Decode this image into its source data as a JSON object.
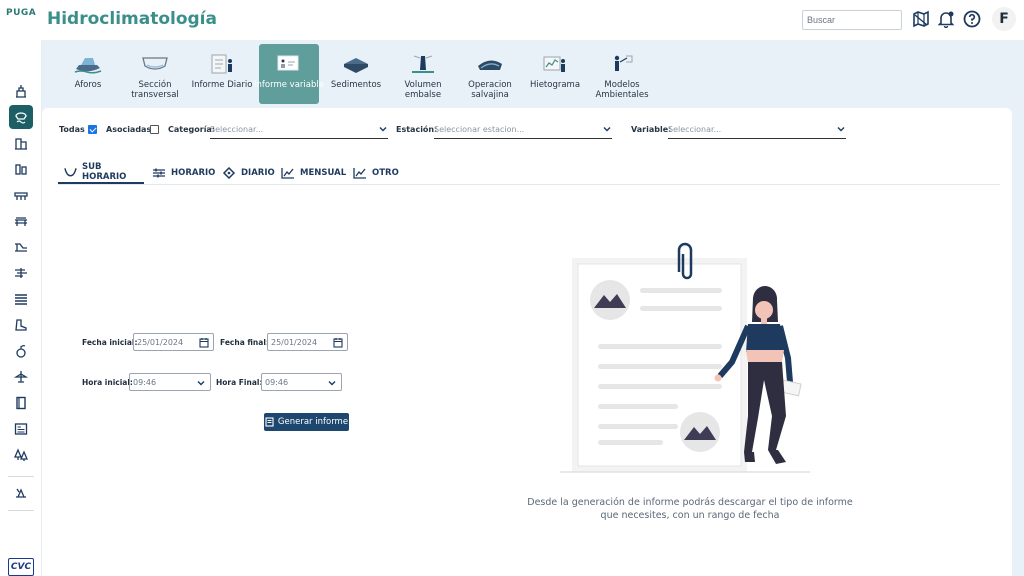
{
  "app": {
    "logo": "PUGA",
    "title": "Hidroclimatología"
  },
  "header": {
    "search_placeholder": "Buscar",
    "avatar_initial": "F"
  },
  "sidebar": {
    "footer_logo": "CVC"
  },
  "modules": [
    {
      "label": "Aforos",
      "active": false
    },
    {
      "label": "Sección transversal",
      "active": false
    },
    {
      "label": "Informe Diario",
      "active": false
    },
    {
      "label": "Informe variable",
      "active": true
    },
    {
      "label": "Sedimentos",
      "active": false
    },
    {
      "label": "Volumen embalse",
      "active": false
    },
    {
      "label": "Operacion salvajina",
      "active": false
    },
    {
      "label": "Hietograma",
      "active": false
    },
    {
      "label": "Modelos Ambientales",
      "active": false
    }
  ],
  "filters": {
    "todas_label": "Todas",
    "todas_checked": true,
    "asociadas_label": "Asociadas",
    "asociadas_checked": false,
    "categoria_label": "Categoría:",
    "categoria_placeholder": "Seleccionar...",
    "estacion_label": "Estación:",
    "estacion_placeholder": "Seleccionar estacion...",
    "variable_label": "Variable:",
    "variable_placeholder": "Seleccionar..."
  },
  "tabs": [
    {
      "label": "SUB HORARIO",
      "active": true
    },
    {
      "label": "HORARIO",
      "active": false
    },
    {
      "label": "DIARIO",
      "active": false
    },
    {
      "label": "MENSUAL",
      "active": false
    },
    {
      "label": "OTRO",
      "active": false
    }
  ],
  "form": {
    "fecha_inicial_label": "Fecha inicial:",
    "fecha_inicial_value": "25/01/2024",
    "fecha_final_label": "Fecha final:",
    "fecha_final_value": "25/01/2024",
    "hora_inicial_label": "Hora inicial:",
    "hora_inicial_value": "09:46",
    "hora_final_label": "Hora Final:",
    "hora_final_value": "09:46",
    "generate_button": "Generar informe"
  },
  "empty_state": {
    "line1": "Desde la generación de informe podrás descargar el tipo de informe",
    "line2": "que necesites, con un rango de fecha"
  },
  "colors": {
    "accent": "#3a8f8a",
    "active_module": "#5f9e9a",
    "sidebar_active": "#1e5f66",
    "primary_button": "#1e4770",
    "content_bg": "#e9f1f8",
    "person_top": "#1e3a5f"
  }
}
